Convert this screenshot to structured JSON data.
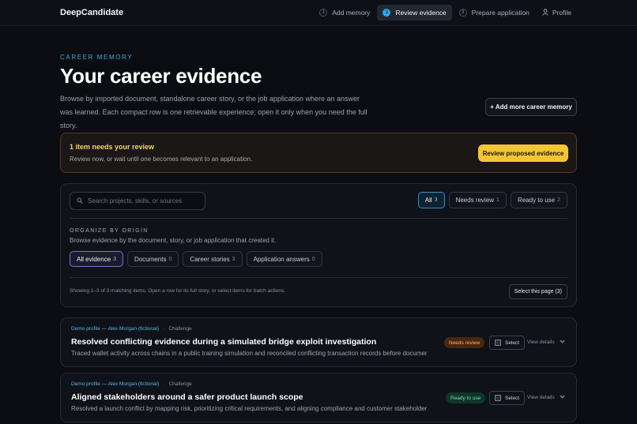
{
  "app": {
    "brand": "DeepCandidate"
  },
  "nav": {
    "steps": [
      {
        "num": "1",
        "label": "Add memory",
        "active": false
      },
      {
        "num": "2",
        "label": "Review evidence",
        "active": true
      },
      {
        "num": "3",
        "label": "Prepare application",
        "active": false
      }
    ],
    "profile_label": "Profile",
    "profile_icon": "user-icon"
  },
  "header": {
    "eyebrow": "CAREER MEMORY",
    "title": "Your career evidence",
    "intro": "Browse by imported document, standalone career story, or the job application where an answer was learned. Each compact row is one retrievable experience; open it only when you need the full story.",
    "add_button": "+ Add more career memory"
  },
  "review_banner": {
    "title": "1 item needs your review",
    "subtitle": "Review now, or wait until one becomes relevant to an application.",
    "button": "Review proposed evidence"
  },
  "filters": {
    "search_placeholder": "Search projects, skills, or sources",
    "status_tabs": [
      {
        "label": "All",
        "count": "3",
        "active": true
      },
      {
        "label": "Needs review",
        "count": "1",
        "active": false
      },
      {
        "label": "Ready to use",
        "count": "2",
        "active": false
      }
    ],
    "origin_label": "ORGANIZE BY ORIGIN",
    "origin_sub": "Browse evidence by the document, story, or job application that created it.",
    "origin_tabs": [
      {
        "label": "All evidence",
        "count": "3",
        "active": true
      },
      {
        "label": "Documents",
        "count": "0",
        "active": false
      },
      {
        "label": "Career stories",
        "count": "3",
        "active": false
      },
      {
        "label": "Application answers",
        "count": "0",
        "active": false
      }
    ],
    "showing": "Showing 1–3 of 3 matching items. Open a row for its full story, or select items for batch actions.",
    "select_page": "Select this page (3)"
  },
  "items": [
    {
      "source": "Demo profile — Alex Morgan (fictional)",
      "separator": "·",
      "kind": "Challenge",
      "title": "Resolved conflicting evidence during a simulated bridge exploit investigation",
      "description": "Traced wallet activity across chains in a public training simulation and reconciled conflicting transaction records before documenting…",
      "status": "Needs review",
      "select": "Select",
      "view": "View details"
    },
    {
      "source": "Demo profile — Alex Morgan (fictional)",
      "separator": "·",
      "kind": "Challenge",
      "title": "Aligned stakeholders around a safer product launch scope",
      "description": "Resolved a launch conflict by mapping risk, prioritizing critical requirements, and aligning compliance and customer stakeholders on…",
      "status": "Ready to use",
      "select": "Select",
      "view": "View details"
    }
  ]
}
